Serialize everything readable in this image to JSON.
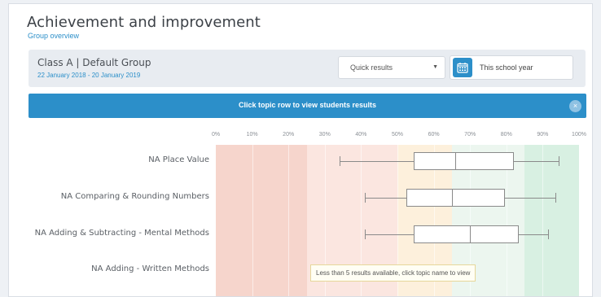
{
  "header": {
    "title": "Achievement and improvement",
    "subtitle": "Group overview"
  },
  "class_bar": {
    "name": "Class A | Default Group",
    "dates": "22 January 2018 - 20 January 2019",
    "quick_results": "Quick results",
    "date_range": "This school year"
  },
  "banner": {
    "text": "Click topic row to view students results",
    "close_icon": "×"
  },
  "axis": {
    "ticks": [
      "0%",
      "10%",
      "20%",
      "30%",
      "40%",
      "50%",
      "60%",
      "70%",
      "80%",
      "90%",
      "100%"
    ]
  },
  "zones": [
    {
      "from": 0,
      "to": 25,
      "color": "#f6d5cc"
    },
    {
      "from": 25,
      "to": 50,
      "color": "#fbe6e0"
    },
    {
      "from": 50,
      "to": 65,
      "color": "#fdf0dc"
    },
    {
      "from": 65,
      "to": 85,
      "color": "#ecf6ef"
    },
    {
      "from": 85,
      "to": 100,
      "color": "#d8f0e2"
    }
  ],
  "chart_data": {
    "type": "boxplot",
    "x_range": [
      0,
      100
    ],
    "x_unit": "%",
    "rows": [
      {
        "label": "NA Place Value",
        "min": 34,
        "q1": 54.5,
        "median": 66,
        "q3": 82,
        "max": 94.5
      },
      {
        "label": "NA Comparing & Rounding Numbers",
        "min": 41,
        "q1": 52.5,
        "median": 65,
        "q3": 79.5,
        "max": 93.5
      },
      {
        "label": "NA Adding & Subtracting - Mental Methods",
        "min": 41,
        "q1": 54.5,
        "median": 70,
        "q3": 83.5,
        "max": 91.5
      },
      {
        "label": "NA Adding - Written Methods"
      }
    ]
  },
  "tooltip": {
    "text": "Less than 5 results available, click topic name to view"
  }
}
